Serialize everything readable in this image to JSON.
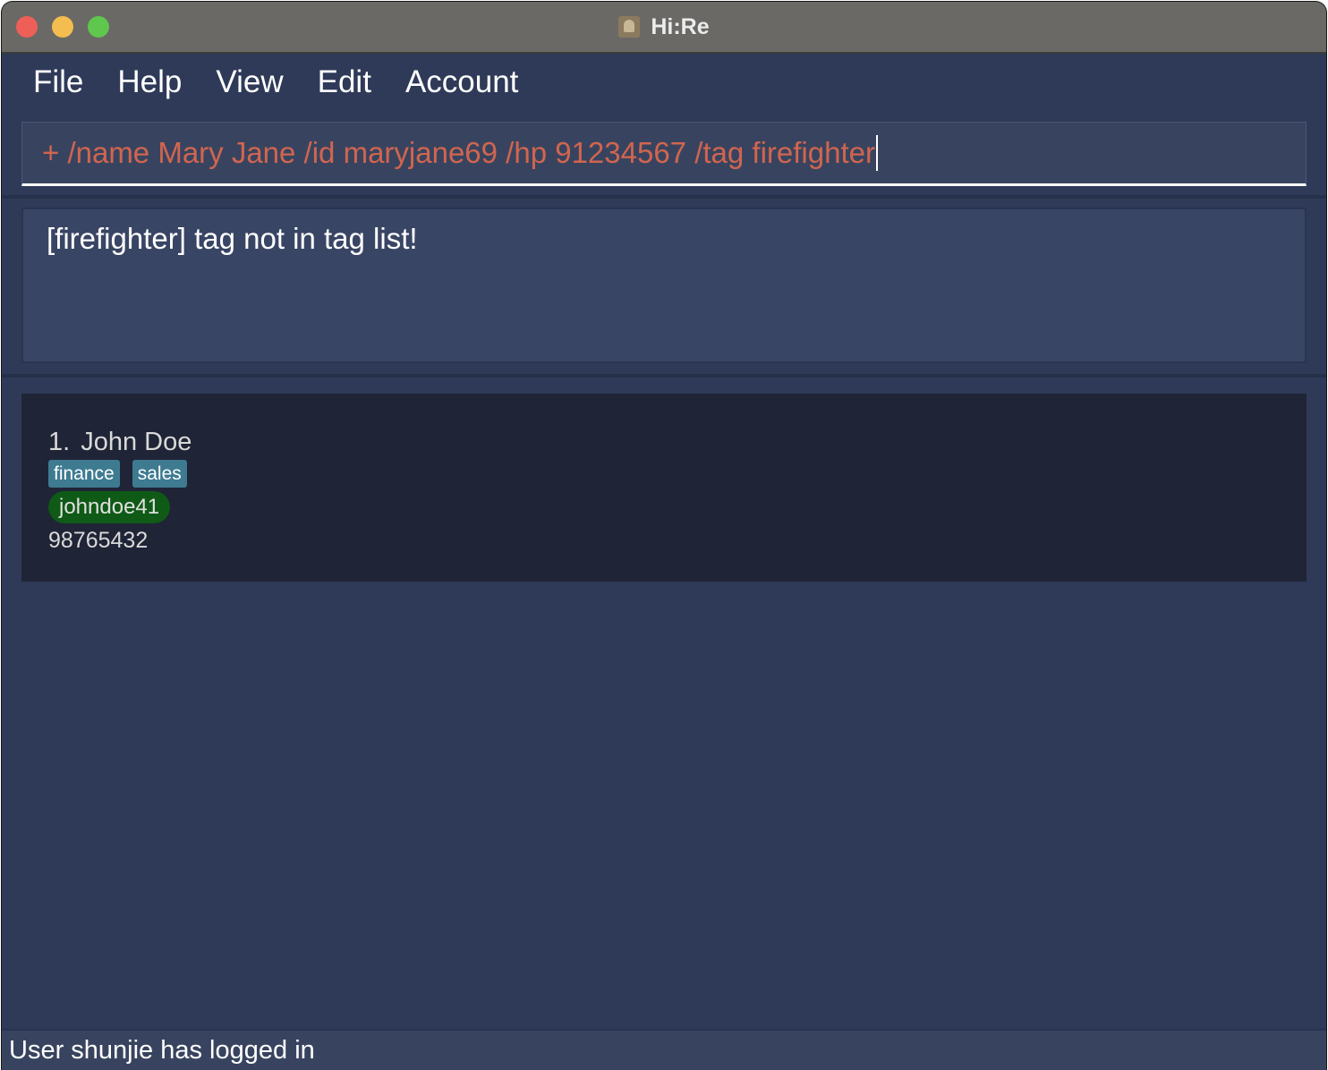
{
  "window": {
    "title": "Hi:Re",
    "app_icon": "address-book-icon"
  },
  "menu": {
    "items": [
      "File",
      "Help",
      "View",
      "Edit",
      "Account"
    ]
  },
  "command": {
    "value": "+ /name Mary Jane /id maryjane69 /hp 91234567 /tag firefighter",
    "text_color": "#d1654f"
  },
  "result": {
    "message": "[firefighter] tag not in tag list!"
  },
  "people": [
    {
      "index": "1.",
      "name": "John Doe",
      "tags": [
        "finance",
        "sales"
      ],
      "user_id": "johndoe41",
      "phone": "98765432"
    }
  ],
  "status": {
    "message": "User shunjie has logged in"
  },
  "colors": {
    "background": "#2f3a58",
    "card": "#1f2436",
    "tag": "#3e7b91",
    "user_id_badge": "#0f5a16"
  }
}
